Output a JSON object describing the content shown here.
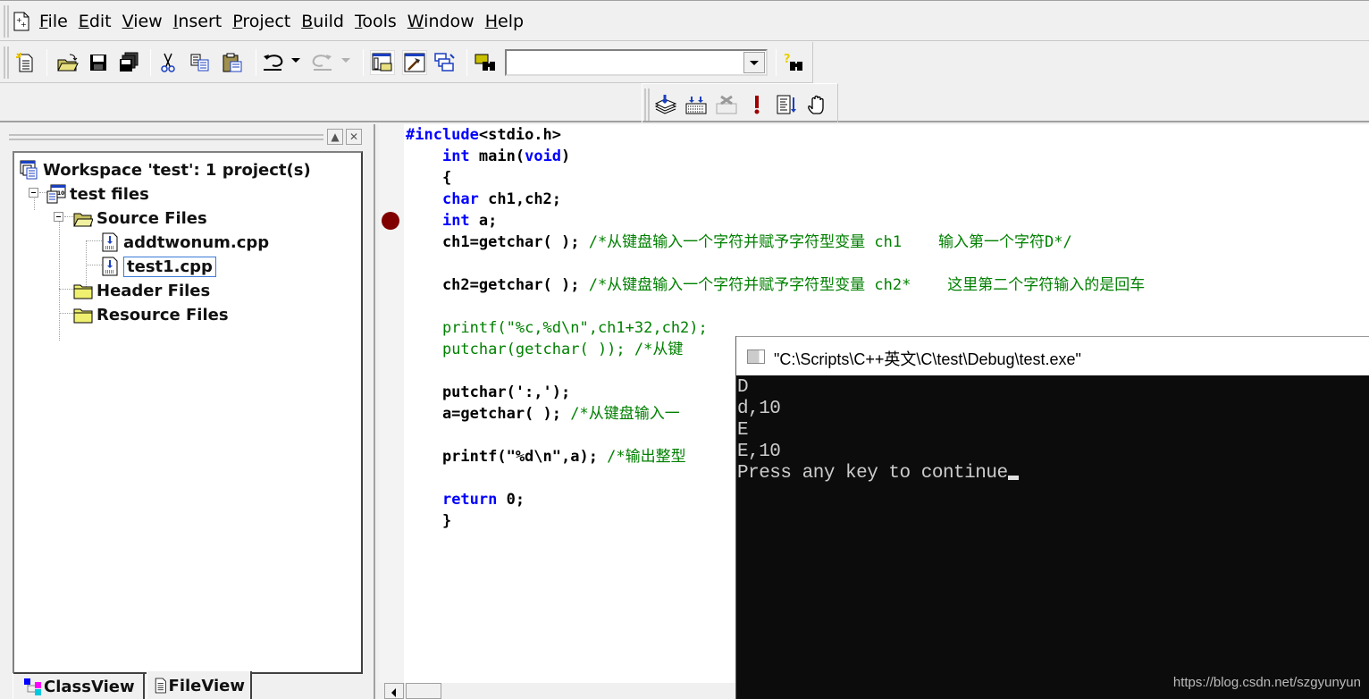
{
  "menubar": {
    "items": [
      {
        "label": "File",
        "key": "F"
      },
      {
        "label": "Edit",
        "key": "E"
      },
      {
        "label": "View",
        "key": "V"
      },
      {
        "label": "Insert",
        "key": "I"
      },
      {
        "label": "Project",
        "key": "P"
      },
      {
        "label": "Build",
        "key": "B"
      },
      {
        "label": "Tools",
        "key": "T"
      },
      {
        "label": "Window",
        "key": "W"
      },
      {
        "label": "Help",
        "key": "H"
      }
    ]
  },
  "toolbar": {
    "find_combo_value": "",
    "buttons": [
      "new-text-file",
      "open",
      "save",
      "save-all",
      "cut",
      "copy",
      "paste",
      "undo",
      "redo",
      "workspace",
      "output",
      "window-list",
      "find-in-files",
      "search"
    ],
    "build_buttons": [
      "compile",
      "build",
      "stop-build",
      "execute",
      "go",
      "insert-breakpoint"
    ]
  },
  "workspace": {
    "tree": {
      "root": "Workspace 'test': 1 project(s)",
      "project": "test files",
      "source_folder": "Source Files",
      "files": [
        "addtwonum.cpp",
        "test1.cpp"
      ],
      "selected_file": "test1.cpp",
      "header_folder": "Header Files",
      "resource_folder": "Resource Files"
    },
    "tabs": [
      {
        "label": "ClassView",
        "active": false
      },
      {
        "label": "FileView",
        "active": true
      }
    ]
  },
  "editor": {
    "breakpoint_line": 5,
    "lines": [
      [
        {
          "t": "#include",
          "c": "kw"
        },
        {
          "t": "<stdio.h>",
          "c": ""
        }
      ],
      [
        {
          "t": "    ",
          "c": ""
        },
        {
          "t": "int",
          "c": "kw"
        },
        {
          "t": " main(",
          "c": ""
        },
        {
          "t": "void",
          "c": "kw"
        },
        {
          "t": ")",
          "c": ""
        }
      ],
      [
        {
          "t": "    {",
          "c": ""
        }
      ],
      [
        {
          "t": "    ",
          "c": ""
        },
        {
          "t": "char",
          "c": "kw"
        },
        {
          "t": " ch1,ch2;",
          "c": ""
        }
      ],
      [
        {
          "t": "    ",
          "c": ""
        },
        {
          "t": "int",
          "c": "kw"
        },
        {
          "t": " a;",
          "c": ""
        }
      ],
      [
        {
          "t": "    ch1=getchar( ); ",
          "c": ""
        },
        {
          "t": "/*从键盘输入一个字符并赋予字符型变量 ch1    输入第一个字符D*/",
          "c": "cm"
        }
      ],
      [
        {
          "t": "",
          "c": ""
        }
      ],
      [
        {
          "t": "    ch2=getchar( ); ",
          "c": ""
        },
        {
          "t": "/*从键盘输入一个字符并赋予字符型变量 ch2*    这里第二个字符输入的是回车",
          "c": "cm"
        }
      ],
      [
        {
          "t": "",
          "c": ""
        }
      ],
      [
        {
          "t": "    ",
          "c": ""
        },
        {
          "t": "printf(\"%c,%d\\n\",ch1+32,ch2);",
          "c": "cm"
        }
      ],
      [
        {
          "t": "    ",
          "c": ""
        },
        {
          "t": "putchar(getchar( )); /*从键",
          "c": "cm"
        }
      ],
      [
        {
          "t": "",
          "c": ""
        }
      ],
      [
        {
          "t": "    putchar(':,');",
          "c": ""
        }
      ],
      [
        {
          "t": "    a=getchar( ); ",
          "c": ""
        },
        {
          "t": "/*从键盘输入一",
          "c": "cm"
        }
      ],
      [
        {
          "t": "",
          "c": ""
        }
      ],
      [
        {
          "t": "    printf(\"%d\\n\",a); ",
          "c": ""
        },
        {
          "t": "/*输出整型",
          "c": "cm"
        }
      ],
      [
        {
          "t": "",
          "c": ""
        }
      ],
      [
        {
          "t": "    ",
          "c": ""
        },
        {
          "t": "return",
          "c": "kw"
        },
        {
          "t": " 0;",
          "c": ""
        }
      ],
      [
        {
          "t": "    }",
          "c": ""
        }
      ]
    ]
  },
  "console": {
    "title": "\"C:\\Scripts\\C++英文\\C\\test\\Debug\\test.exe\"",
    "lines": [
      "D",
      "d,10",
      "E",
      "E,10",
      "Press any key to continue"
    ],
    "watermark": "https://blog.csdn.net/szgyunyun"
  }
}
